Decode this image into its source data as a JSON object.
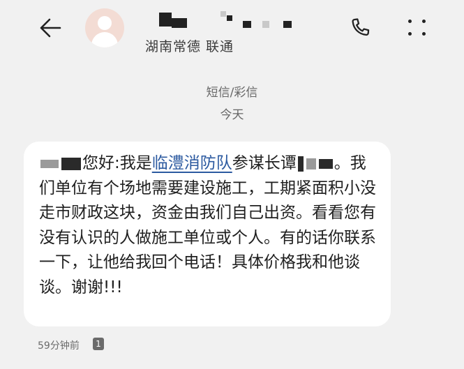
{
  "header": {
    "back_icon": "arrow-left-icon",
    "avatar_icon": "person-icon",
    "contact_name_redacted": true,
    "location": "湖南常德 联通",
    "call_icon": "phone-icon",
    "more_icon": "more-vertical-dots-icon"
  },
  "thread": {
    "message_type": "短信/彩信",
    "day_label": "今天"
  },
  "message": {
    "greeting": "您好:我是",
    "link_text": "临澧消防队",
    "after_link": "参谋长谭",
    "body": "。我们单位有个场地需要建设施工，工期紧面积小没走市财政这块，资金由我们自己出资。看看您有没有认识的人做施工单位或个人。有的话你联系一下，让他给我回个电话！具体价格我和他谈谈。谢谢!!!",
    "link_color": "#2c5aa0",
    "bubble_color": "#ffffff",
    "background_color": "#f1f1f1"
  },
  "meta": {
    "timestamp": "59分钟前",
    "sim_badge": "1"
  }
}
